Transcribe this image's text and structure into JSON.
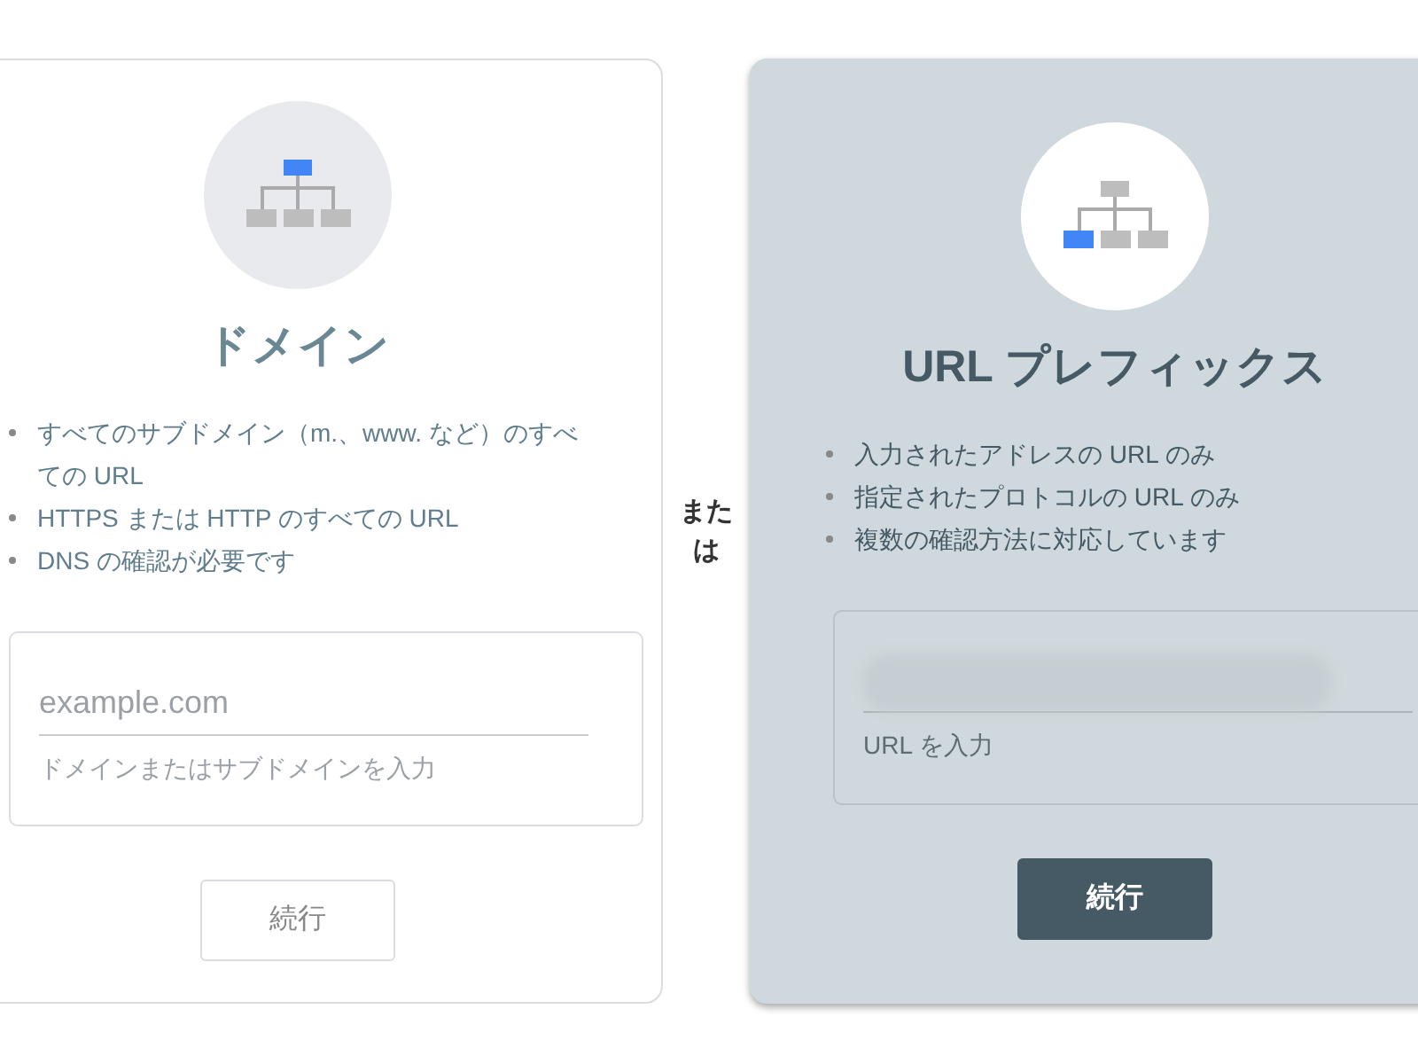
{
  "cards": [
    {
      "kind": "domain",
      "selected": false,
      "title": "ドメイン",
      "bullets": [
        "すべてのサブドメイン（m.、www. など）のすべての URL",
        "HTTPS または HTTP のすべての URL",
        "DNS の確認が必要です"
      ],
      "field": {
        "placeholder": "example.com",
        "redacted": false,
        "helper": "ドメインまたはサブドメインを入力"
      },
      "button": "続行"
    },
    {
      "kind": "prefix",
      "selected": true,
      "title": "URL プレフィックス",
      "bullets": [
        "入力されたアドレスの URL のみ",
        "指定されたプロトコルの URL のみ",
        "複数の確認方法に対応しています"
      ],
      "field": {
        "redacted": true,
        "helper": "URL を入力"
      },
      "button": "続行"
    }
  ],
  "separator": "または"
}
